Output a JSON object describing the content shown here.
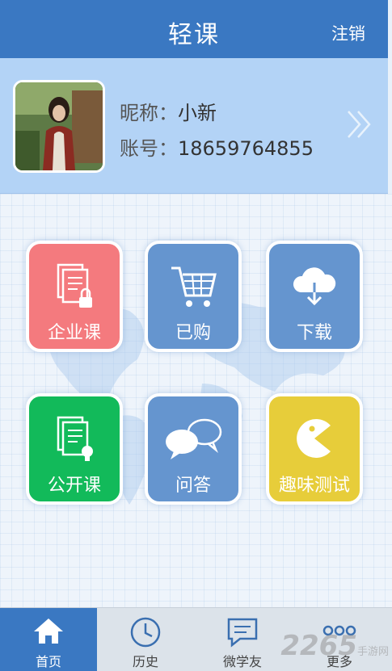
{
  "header": {
    "title": "轻课",
    "logout_label": "注销"
  },
  "profile": {
    "nickname_label": "昵称：",
    "nickname": "小新",
    "account_label": "账号：",
    "account": "18659764855"
  },
  "tiles": [
    {
      "label": "企业课",
      "icon": "document-lock-icon",
      "color": "#f47a7e"
    },
    {
      "label": "已购",
      "icon": "cart-icon",
      "color": "#6595cf"
    },
    {
      "label": "下载",
      "icon": "cloud-download-icon",
      "color": "#6595cf"
    },
    {
      "label": "公开课",
      "icon": "document-bulb-icon",
      "color": "#12ba5a"
    },
    {
      "label": "问答",
      "icon": "chat-bubbles-icon",
      "color": "#6595cf"
    },
    {
      "label": "趣味测试",
      "icon": "pacman-icon",
      "color": "#e7cd3a"
    }
  ],
  "nav": {
    "items": [
      {
        "label": "首页",
        "icon": "home-icon",
        "active": true
      },
      {
        "label": "历史",
        "icon": "clock-icon",
        "active": false
      },
      {
        "label": "微学友",
        "icon": "chat-icon",
        "active": false
      },
      {
        "label": "更多",
        "icon": "more-dots-icon",
        "active": false
      }
    ]
  },
  "watermark": {
    "brand": "2265",
    "site": "手游网"
  },
  "colors": {
    "header": "#3a78c2",
    "profile_bg": "#b3d3f6",
    "nav_bg": "#dce3ea",
    "nav_active": "#3a78c2"
  }
}
